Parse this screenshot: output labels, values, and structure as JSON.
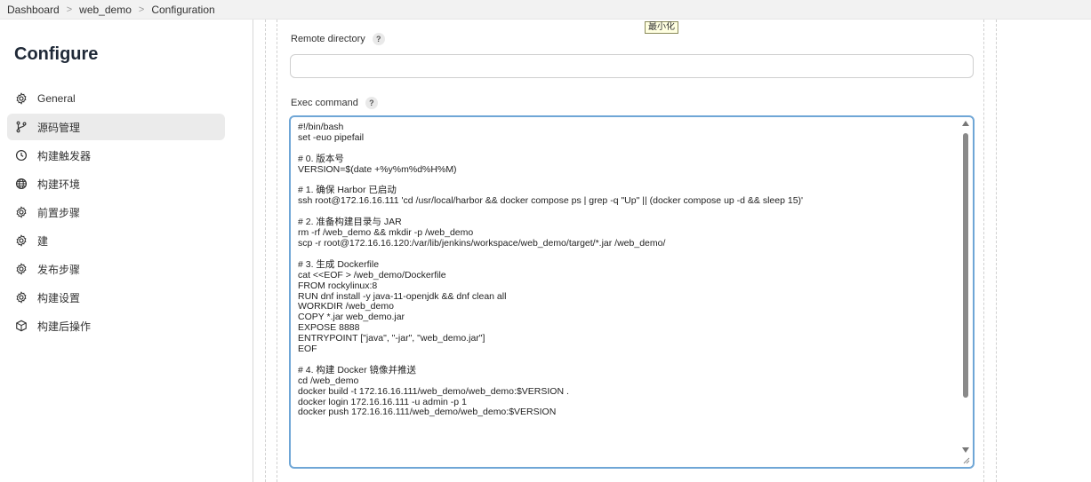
{
  "breadcrumb": [
    "Dashboard",
    "web_demo",
    "Configuration"
  ],
  "breadcrumb_sep": ">",
  "sidebar": {
    "title": "Configure",
    "items": [
      {
        "label": "General",
        "icon": "gear-icon"
      },
      {
        "label": "源码管理",
        "icon": "branch-icon"
      },
      {
        "label": "构建触发器",
        "icon": "clock-icon"
      },
      {
        "label": "构建环境",
        "icon": "globe-icon"
      },
      {
        "label": "前置步骤",
        "icon": "gear-icon"
      },
      {
        "label": "建",
        "icon": "gear-icon"
      },
      {
        "label": "发布步骤",
        "icon": "gear-icon"
      },
      {
        "label": "构建设置",
        "icon": "gear-icon"
      },
      {
        "label": "构建后操作",
        "icon": "package-icon"
      }
    ]
  },
  "tooltip": "最小化",
  "remote_directory": {
    "label": "Remote directory",
    "help": "?",
    "value": ""
  },
  "exec_command": {
    "label": "Exec command",
    "help": "?",
    "value": "#!/bin/bash\nset -euo pipefail\n\n# 0. 版本号\nVERSION=$(date +%y%m%d%H%M)\n\n# 1. 确保 Harbor 已启动\nssh root@172.16.16.111 'cd /usr/local/harbor && docker compose ps | grep -q \"Up\" || (docker compose up -d && sleep 15)'\n\n# 2. 准备构建目录与 JAR\nrm -rf /web_demo && mkdir -p /web_demo\nscp -r root@172.16.16.120:/var/lib/jenkins/workspace/web_demo/target/*.jar /web_demo/\n\n# 3. 生成 Dockerfile\ncat <<EOF > /web_demo/Dockerfile\nFROM rockylinux:8\nRUN dnf install -y java-11-openjdk && dnf clean all\nWORKDIR /web_demo\nCOPY *.jar web_demo.jar\nEXPOSE 8888\nENTRYPOINT [\"java\", \"-jar\", \"web_demo.jar\"]\nEOF\n\n# 4. 构建 Docker 镜像并推送\ncd /web_demo\ndocker build -t 172.16.16.111/web_demo/web_demo:$VERSION .\ndocker login 172.16.16.111 -u admin -p 1\ndocker push 172.16.16.111/web_demo/web_demo:$VERSION"
  }
}
